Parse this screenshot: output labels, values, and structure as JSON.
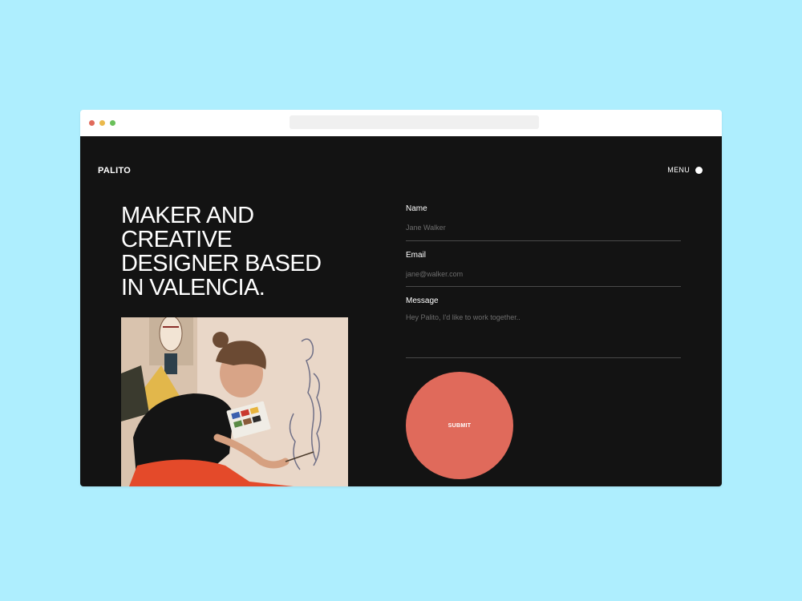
{
  "site": {
    "logo": "PALITO",
    "menu_label": "MENU",
    "headline": "MAKER AND\nCREATIVE\nDESIGNER BASED\nIN VALENCIA."
  },
  "form": {
    "name_label": "Name",
    "name_placeholder": "Jane Walker",
    "email_label": "Email",
    "email_placeholder": "jane@walker.com",
    "message_label": "Message",
    "message_placeholder": "Hey Palito, I'd like to work together..",
    "submit_label": "SUBMIT"
  },
  "colors": {
    "background": "#aeeefe",
    "site_background": "#131313",
    "accent": "#e06a5b"
  }
}
